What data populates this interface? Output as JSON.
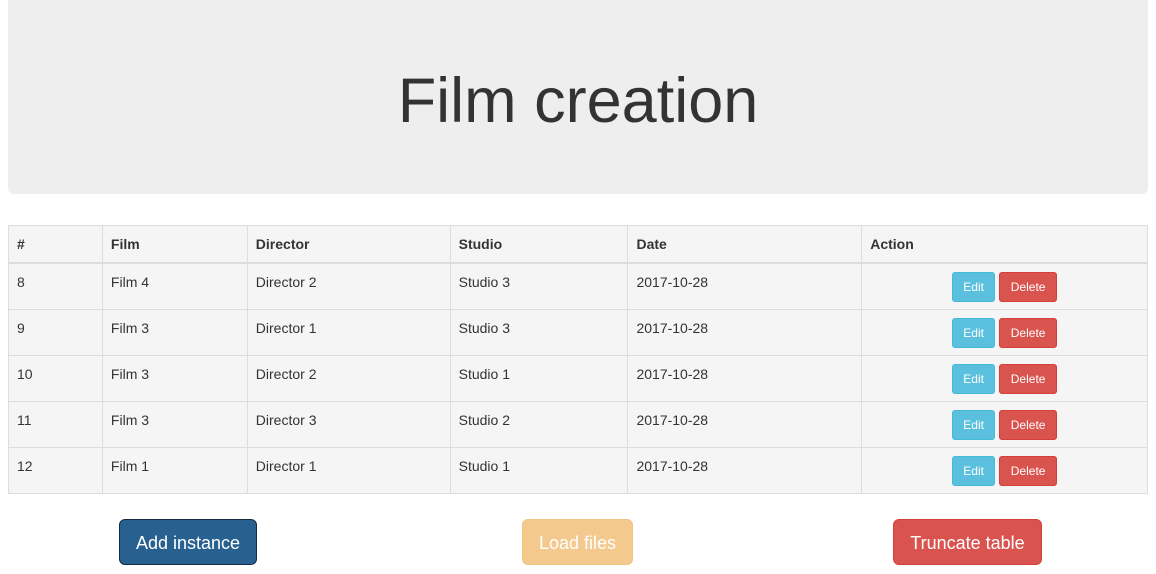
{
  "header": {
    "title": "Film creation"
  },
  "table": {
    "columns": [
      "#",
      "Film",
      "Director",
      "Studio",
      "Date",
      "Action"
    ],
    "rows": [
      {
        "id": "8",
        "film": "Film 4",
        "director": "Director 2",
        "studio": "Studio 3",
        "date": "2017-10-28"
      },
      {
        "id": "9",
        "film": "Film 3",
        "director": "Director 1",
        "studio": "Studio 3",
        "date": "2017-10-28"
      },
      {
        "id": "10",
        "film": "Film 3",
        "director": "Director 2",
        "studio": "Studio 1",
        "date": "2017-10-28"
      },
      {
        "id": "11",
        "film": "Film 3",
        "director": "Director 3",
        "studio": "Studio 2",
        "date": "2017-10-28"
      },
      {
        "id": "12",
        "film": "Film 1",
        "director": "Director 1",
        "studio": "Studio 1",
        "date": "2017-10-28"
      }
    ],
    "edit_label": "Edit",
    "delete_label": "Delete"
  },
  "footer": {
    "add_label": "Add instance",
    "load_label": "Load files",
    "truncate_label": "Truncate table"
  },
  "colors": {
    "jumbotron_bg": "#eeeeee",
    "table_bg": "#f5f5f5",
    "info": "#5bc0de",
    "danger": "#d9534f",
    "primary": "#286090",
    "warning_disabled": "#f4c98d"
  }
}
